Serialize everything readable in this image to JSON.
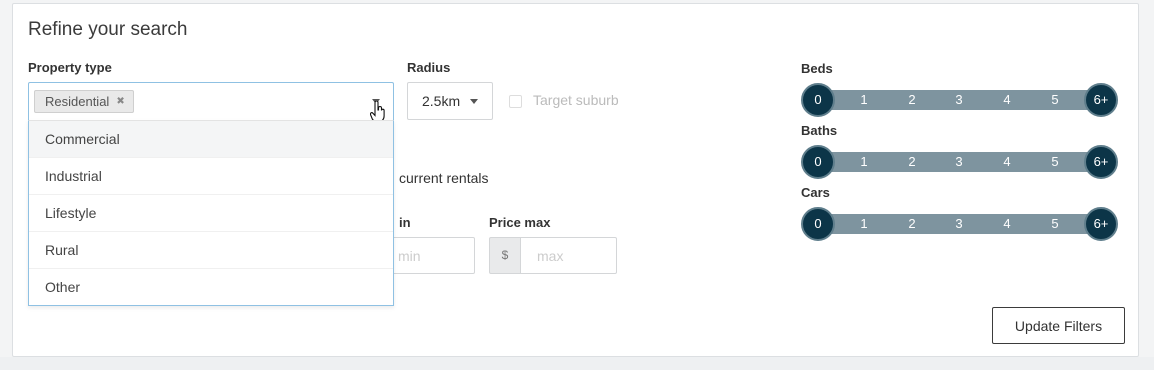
{
  "title": "Refine your search",
  "property_type": {
    "label": "Property type",
    "selected_tag": "Residential",
    "tag_remove": "✖",
    "options": [
      "Commercial",
      "Industrial",
      "Lifestyle",
      "Rural",
      "Other"
    ]
  },
  "radius": {
    "label": "Radius",
    "value": "2.5km"
  },
  "target_suburb": {
    "label": "Target suburb",
    "checked": false
  },
  "partially_hidden": {
    "rentals_text": "current rentals",
    "price_min_label_fragment": "in",
    "price_min_placeholder_fragment": "min"
  },
  "price_max": {
    "label": "Price max",
    "currency": "$",
    "placeholder": "max"
  },
  "sliders": [
    {
      "label": "Beds",
      "min_label": "0",
      "max_label": "6+",
      "ticks": [
        "1",
        "2",
        "3",
        "4",
        "5"
      ]
    },
    {
      "label": "Baths",
      "min_label": "0",
      "max_label": "6+",
      "ticks": [
        "1",
        "2",
        "3",
        "4",
        "5"
      ]
    },
    {
      "label": "Cars",
      "min_label": "0",
      "max_label": "6+",
      "ticks": [
        "1",
        "2",
        "3",
        "4",
        "5"
      ]
    }
  ],
  "update_button": "Update Filters",
  "colors": {
    "accent_dark": "#0c3548",
    "track": "#7e949f",
    "focus_border": "#8fc1e3"
  }
}
